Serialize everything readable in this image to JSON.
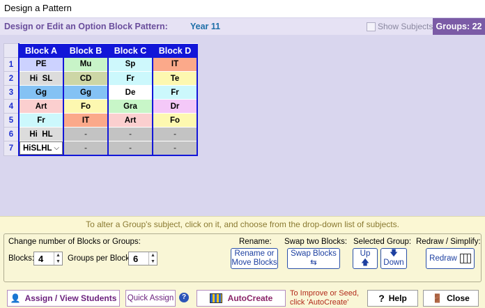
{
  "window": {
    "title": "Design a Pattern"
  },
  "header": {
    "label": "Design or Edit an Option Block Pattern:",
    "year": "Year 11",
    "show_subjects": "Show Subjects",
    "groups": "Groups: 22"
  },
  "grid": {
    "columns": [
      "Block A",
      "Block B",
      "Block C",
      "Block D"
    ],
    "rows": [
      {
        "n": "1",
        "cells": [
          {
            "t": "PE",
            "c": "#ccd2ff"
          },
          {
            "t": "Mu",
            "c": "#c8f4c8"
          },
          {
            "t": "Sp",
            "c": "#cef8fc"
          },
          {
            "t": "IT",
            "c": "#fba98a"
          }
        ]
      },
      {
        "n": "2",
        "cells": [
          {
            "t": "Hi  SL",
            "c": "#dcdcdc"
          },
          {
            "t": "CD",
            "c": "#cdd6a6"
          },
          {
            "t": "Fr",
            "c": "#ccf8fc"
          },
          {
            "t": "Te",
            "c": "#fdf8b0"
          }
        ]
      },
      {
        "n": "3",
        "cells": [
          {
            "t": "Gg",
            "c": "#84c2f4"
          },
          {
            "t": "Gg",
            "c": "#84c2f4"
          },
          {
            "t": "De",
            "c": "#ffffff"
          },
          {
            "t": "Fr",
            "c": "#ccf8fc"
          }
        ]
      },
      {
        "n": "4",
        "cells": [
          {
            "t": "Art",
            "c": "#fbcfcf"
          },
          {
            "t": "Fo",
            "c": "#fdf8b0"
          },
          {
            "t": "Gra",
            "c": "#c8f6c8"
          },
          {
            "t": "Dr",
            "c": "#f4c8f8"
          }
        ]
      },
      {
        "n": "5",
        "cells": [
          {
            "t": "Fr",
            "c": "#ccf8fc"
          },
          {
            "t": "IT",
            "c": "#fba98a"
          },
          {
            "t": "Art",
            "c": "#fbcfcf"
          },
          {
            "t": "Fo",
            "c": "#fdf8b0"
          }
        ]
      },
      {
        "n": "6",
        "cells": [
          {
            "t": "Hi  HL",
            "c": "#dcdcdc"
          },
          {
            "t": "-",
            "c": "#c3c3c3"
          },
          {
            "t": "-",
            "c": "#c3c3c3"
          },
          {
            "t": "-",
            "c": "#c3c3c3"
          }
        ]
      },
      {
        "n": "7",
        "cells": [
          {
            "t": "HiSLHL",
            "c": "#ffffff",
            "select": true
          },
          {
            "t": "-",
            "c": "#c3c3c3"
          },
          {
            "t": "-",
            "c": "#c3c3c3"
          },
          {
            "t": "-",
            "c": "#c3c3c3"
          }
        ]
      }
    ]
  },
  "hint": "To alter a Group's subject, click on it, and choose from the drop-down list of subjects.",
  "controls": {
    "change_label": "Change number of Blocks or Groups:",
    "blocks_label": "Blocks:",
    "blocks_value": "4",
    "gpb_label": "Groups per Block:",
    "gpb_value": "6",
    "rename_label": "Rename:",
    "rename_btn1": "Rename or",
    "rename_btn2": "Move Blocks",
    "swap_label": "Swap two Blocks:",
    "swap_btn": "Swap Blocks",
    "selgroup_label": "Selected Group:",
    "up_btn": "Up",
    "down_btn": "Down",
    "redraw_label": "Redraw / Simplify:",
    "redraw_btn": "Redraw"
  },
  "bottom": {
    "assign": "Assign / View Students",
    "quick": "Quick Assign",
    "autocreate": "AutoCreate",
    "note1": "To Improve or Seed,",
    "note2": "click 'AutoCreate'",
    "help": "Help",
    "close": "Close"
  }
}
